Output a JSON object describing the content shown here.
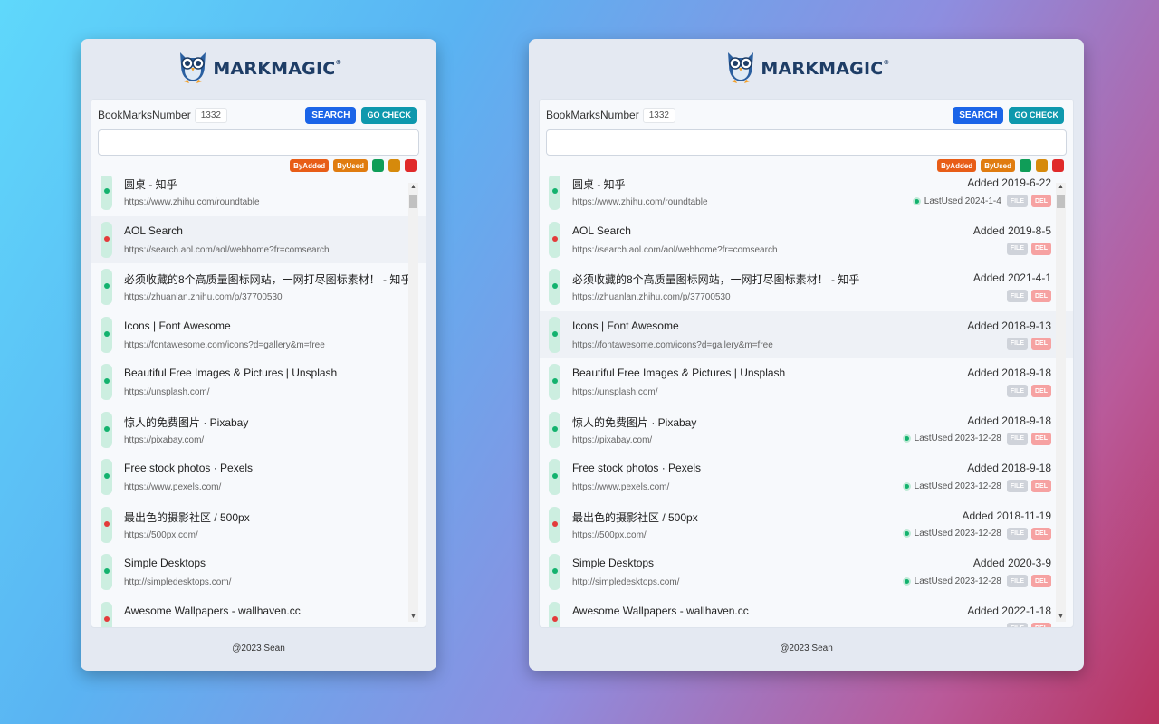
{
  "brand": {
    "name": "MARKMAGIC",
    "mark": "®"
  },
  "header": {
    "bookmarks_label": "BookMarksNumber",
    "bookmarks_count": "1332",
    "search_label": "SEARCH",
    "check_label": "GO CHECK"
  },
  "search": {
    "value": "",
    "placeholder": ""
  },
  "filters": {
    "by_added": "ByAdded",
    "by_used": "ByUsed",
    "colors": [
      "#0f9d58",
      "#d68a0c",
      "#e02a2a"
    ]
  },
  "item_actions": {
    "file": "FILE",
    "del": "DEL"
  },
  "footer": "@2023 Sean",
  "scrollbar": {
    "up": "▲",
    "down": "▼"
  },
  "bookmarks": [
    {
      "title": "圆桌 - 知乎",
      "url": "https://www.zhihu.com/roundtable",
      "status": "green",
      "added": "Added 2019-6-22",
      "last_used": "LastUsed 2024-1-4"
    },
    {
      "title": "AOL Search",
      "url": "https://search.aol.com/aol/webhome?fr=comsearch",
      "status": "red",
      "added": "Added 2019-8-5",
      "last_used": ""
    },
    {
      "title": "必须收藏的8个高质量图标网站，一网打尽图标素材！ - 知乎",
      "url": "https://zhuanlan.zhihu.com/p/37700530",
      "status": "green",
      "added": "Added 2021-4-1",
      "last_used": ""
    },
    {
      "title": "Icons | Font Awesome",
      "url": "https://fontawesome.com/icons?d=gallery&m=free",
      "status": "green",
      "added": "Added 2018-9-13",
      "last_used": ""
    },
    {
      "title": "Beautiful Free Images & Pictures | Unsplash",
      "url": "https://unsplash.com/",
      "status": "green",
      "added": "Added 2018-9-18",
      "last_used": ""
    },
    {
      "title": "惊人的免费图片 · Pixabay",
      "url": "https://pixabay.com/",
      "status": "green",
      "added": "Added 2018-9-18",
      "last_used": "LastUsed 2023-12-28"
    },
    {
      "title": "Free stock photos · Pexels",
      "url": "https://www.pexels.com/",
      "status": "green",
      "added": "Added 2018-9-18",
      "last_used": "LastUsed 2023-12-28"
    },
    {
      "title": "最出色的摄影社区 / 500px",
      "url": "https://500px.com/",
      "status": "red",
      "added": "Added 2018-11-19",
      "last_used": "LastUsed 2023-12-28"
    },
    {
      "title": "Simple Desktops",
      "url": "http://simpledesktops.com/",
      "status": "green",
      "added": "Added 2020-3-9",
      "last_used": "LastUsed 2023-12-28"
    },
    {
      "title": "Awesome Wallpapers - wallhaven.cc",
      "url": "",
      "status": "red",
      "added": "Added 2022-1-18",
      "last_used": ""
    }
  ]
}
